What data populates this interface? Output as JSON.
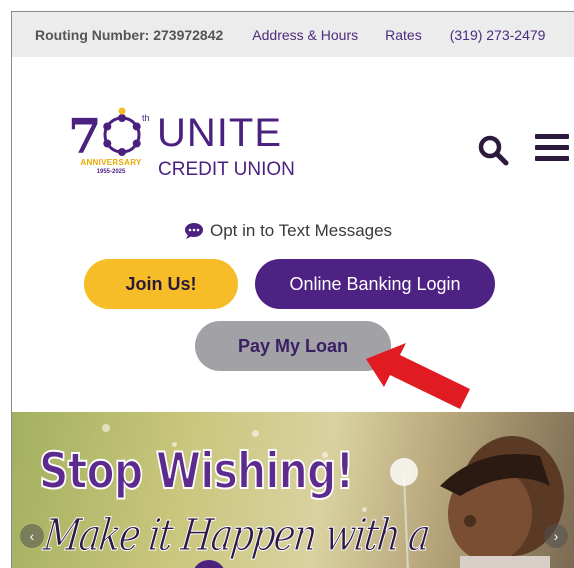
{
  "topbar": {
    "routing": "Routing Number: 273972842",
    "links": [
      "Address & Hours",
      "Rates"
    ],
    "phone": "(319) 273-2479"
  },
  "logo": {
    "name": "UNITE",
    "subname": "CREDIT UNION",
    "anniversary_number": "70",
    "anniversary_suffix": "th",
    "anniversary_label": "ANNIVERSARY",
    "anniversary_years": "1955-2025"
  },
  "header_icons": [
    "search-icon",
    "hamburger-menu-icon"
  ],
  "opt_in": {
    "label": "Opt in to Text Messages",
    "icon": "chat-bubble-icon"
  },
  "buttons": {
    "join": "Join Us!",
    "online_banking": "Online Banking Login",
    "pay_loan": "Pay My Loan"
  },
  "banner": {
    "headline": "Stop Wishing!",
    "subline": "Make it Happen with a"
  },
  "colors": {
    "purple": "#4d2283",
    "gold": "#f6bd28",
    "gray_button": "#a2a2a6",
    "arrow_red": "#e01b22"
  }
}
